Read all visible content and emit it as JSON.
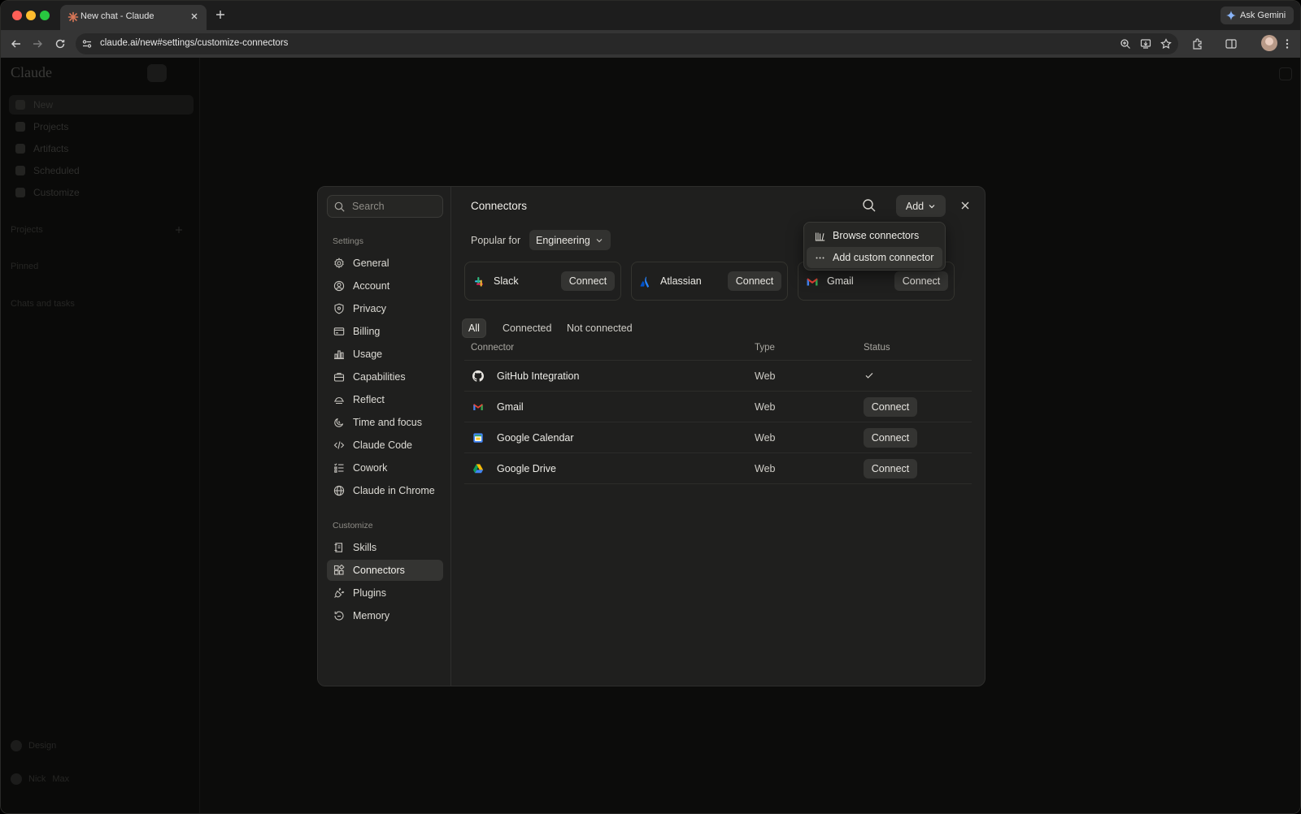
{
  "browser": {
    "tab_title": "New chat - Claude",
    "url": "claude.ai/new#settings/customize-connectors",
    "gemini_label": "Ask Gemini"
  },
  "app": {
    "logo": "Claude",
    "nav": [
      {
        "label": "New",
        "icon": "plus-icon"
      },
      {
        "label": "Projects",
        "icon": "folder-icon"
      },
      {
        "label": "Artifacts",
        "icon": "artifacts-icon"
      },
      {
        "label": "Scheduled",
        "icon": "clock-icon"
      },
      {
        "label": "Customize",
        "icon": "customize-icon"
      }
    ],
    "sections": {
      "projects": "Projects",
      "pinned": "Pinned",
      "chats": "Chats and tasks"
    },
    "bottom": {
      "design": "Design",
      "user": "Nick",
      "plan": "Max"
    }
  },
  "settings": {
    "search_placeholder": "Search",
    "section_settings": "Settings",
    "section_customize": "Customize",
    "items": [
      {
        "label": "General",
        "icon": "gear-icon"
      },
      {
        "label": "Account",
        "icon": "user-circle-icon"
      },
      {
        "label": "Privacy",
        "icon": "shield-icon"
      },
      {
        "label": "Billing",
        "icon": "credit-card-icon"
      },
      {
        "label": "Usage",
        "icon": "bar-chart-icon"
      },
      {
        "label": "Capabilities",
        "icon": "briefcase-icon"
      },
      {
        "label": "Reflect",
        "icon": "sunset-icon"
      },
      {
        "label": "Time and focus",
        "icon": "moon-clock-icon"
      },
      {
        "label": "Claude Code",
        "icon": "code-icon"
      },
      {
        "label": "Cowork",
        "icon": "checklist-icon"
      },
      {
        "label": "Claude in Chrome",
        "icon": "globe-icon"
      }
    ],
    "customize_items": [
      {
        "label": "Skills",
        "icon": "skills-icon"
      },
      {
        "label": "Connectors",
        "icon": "connectors-icon",
        "active": true
      },
      {
        "label": "Plugins",
        "icon": "plug-icon"
      },
      {
        "label": "Memory",
        "icon": "memory-icon"
      }
    ]
  },
  "connectors": {
    "title": "Connectors",
    "add_label": "Add",
    "popular_label": "Popular for",
    "popular_selected": "Engineering",
    "featured": [
      {
        "name": "Slack",
        "button": "Connect",
        "icon": "slack-icon"
      },
      {
        "name": "Atlassian",
        "button": "Connect",
        "icon": "atlassian-icon"
      },
      {
        "name": "Gmail",
        "button": "Connect",
        "icon": "gmail-icon"
      }
    ],
    "filters": [
      "All",
      "Connected",
      "Not connected"
    ],
    "columns": [
      "Connector",
      "Type",
      "Status"
    ],
    "rows": [
      {
        "name": "GitHub Integration",
        "type": "Web",
        "status": "connected",
        "icon": "github-icon"
      },
      {
        "name": "Gmail",
        "type": "Web",
        "status": "Connect",
        "icon": "gmail-icon"
      },
      {
        "name": "Google Calendar",
        "type": "Web",
        "status": "Connect",
        "icon": "google-calendar-icon"
      },
      {
        "name": "Google Drive",
        "type": "Web",
        "status": "Connect",
        "icon": "google-drive-icon"
      }
    ],
    "add_menu": [
      {
        "label": "Browse connectors",
        "icon": "library-icon"
      },
      {
        "label": "Add custom connector",
        "icon": "more-horizontal-icon"
      }
    ]
  },
  "colors": {
    "background": "#0c0c0b",
    "modal": "#1f1f1e",
    "button": "#343432",
    "tab_favicon": "#d97757"
  }
}
